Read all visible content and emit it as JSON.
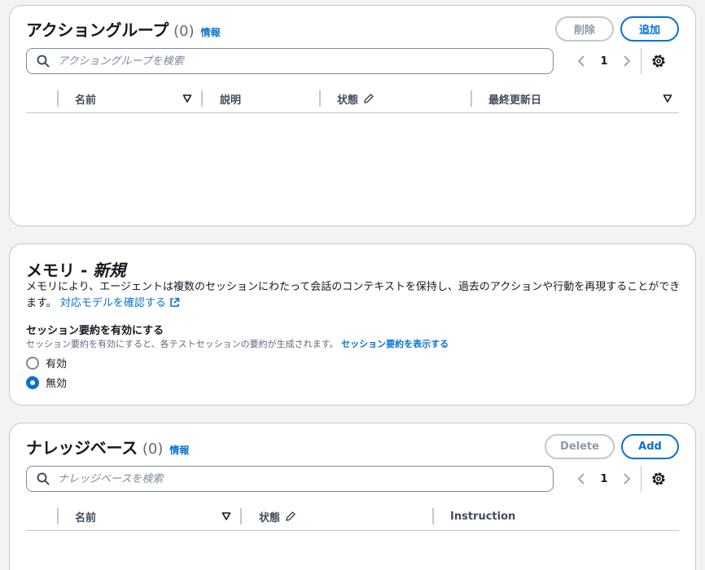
{
  "action_groups": {
    "title": "アクショングループ",
    "count": "(0)",
    "info": "情報",
    "delete_label": "削除",
    "add_label": "追加",
    "search_placeholder": "アクショングループを検索",
    "page": "1",
    "columns": [
      "名前",
      "説明",
      "状態",
      "最終更新日"
    ],
    "icons": {
      "search": "search-icon",
      "prev": "chevron-left-icon",
      "next": "chevron-right-icon",
      "settings": "gear-icon",
      "sort": "sort-down-icon",
      "edit": "pencil-icon"
    }
  },
  "memory": {
    "title": "メモリ - ",
    "title_new": "新規",
    "desc": "メモリにより、エージェントは複数のセッションにわたって会話のコンテキストを保持し、過去のアクションや行動を再現することができます。",
    "models_link": "対応モデルを確認する",
    "summary_label": "セッション要約を有効にする",
    "summary_desc": "セッション要約を有効にすると、各テストセッションの要約が生成されます。",
    "summary_link": "セッション要約を表示する",
    "options": [
      {
        "label": "有効",
        "selected": false
      },
      {
        "label": "無効",
        "selected": true
      }
    ],
    "accent": "#0972d3"
  },
  "knowledge_bases": {
    "title": "ナレッジベース",
    "count": "(0)",
    "info": "情報",
    "delete_label": "Delete",
    "add_label": "Add",
    "search_placeholder": "ナレッジベースを検索",
    "page": "1",
    "columns": [
      "名前",
      "状態",
      "Instruction"
    ]
  }
}
